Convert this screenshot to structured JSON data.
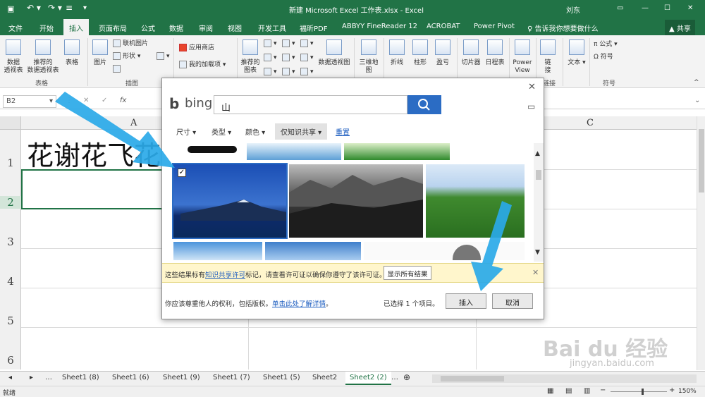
{
  "titlebar": {
    "title": "新建 Microsoft Excel 工作表.xlsx - Excel",
    "user": "刘东"
  },
  "tabs": [
    "文件",
    "开始",
    "插入",
    "页面布局",
    "公式",
    "数据",
    "审阅",
    "视图",
    "开发工具",
    "福昕PDF",
    "ABBYY FineReader 12",
    "ACROBAT",
    "Power Pivot"
  ],
  "tell_me": "告诉我你想要做什么",
  "share": "共享",
  "ribbon": {
    "pivot": "数据\n透视表",
    "rec_pivot": "推荐的\n数据透视表",
    "table": "表格",
    "group_tables": "表格",
    "pictures": "图片",
    "online_pics": "联机图片",
    "shapes": "形状",
    "group_illus": "插图",
    "store": "应用商店",
    "addins": "我的加载项",
    "rec_charts": "推荐的\n图表",
    "pivot_chart": "数据透视图",
    "map3d": "三维地\n图",
    "line": "折线",
    "column": "柱形",
    "winloss": "盈亏",
    "slicer": "切片器",
    "timeline": "日程表",
    "powerview": "Power\nView",
    "link": "链\n接",
    "text": "文本",
    "formula": "公式",
    "symbol": "符号",
    "group_link": "链接",
    "group_symbol": "符号"
  },
  "namebox": "B2",
  "fx": "fx",
  "columns": [
    "A",
    "C"
  ],
  "rows": [
    "1",
    "2",
    "3",
    "4",
    "5",
    "6"
  ],
  "cell_a1": "花谢花飞花",
  "sheets": [
    "Sheet1 (8)",
    "Sheet1 (6)",
    "Sheet1 (9)",
    "Sheet1 (7)",
    "Sheet1 (5)",
    "Sheet2",
    "Sheet2 (2)"
  ],
  "status": {
    "left": "就绪",
    "zoom": "150%"
  },
  "dialog": {
    "brand": "bing",
    "query": "山",
    "filters": [
      "尺寸",
      "类型",
      "颜色",
      "仅知识共享"
    ],
    "reset": "重置",
    "notice_pre": "这些结果标有",
    "notice_link": "知识共享许可",
    "notice_post": "标记，请查看许可证以确保你遵守了该许可证。",
    "show_all": "显示所有结果",
    "rights_pre": "你应该尊重他人的权利，包括版权。",
    "rights_link": "单击此处了解详情",
    "rights_end": "。",
    "selected": "已选择 1 个项目。",
    "insert": "插入",
    "cancel": "取消"
  },
  "watermark": {
    "brand": "Bai du 经验",
    "url": "jingyan.baidu.com"
  }
}
